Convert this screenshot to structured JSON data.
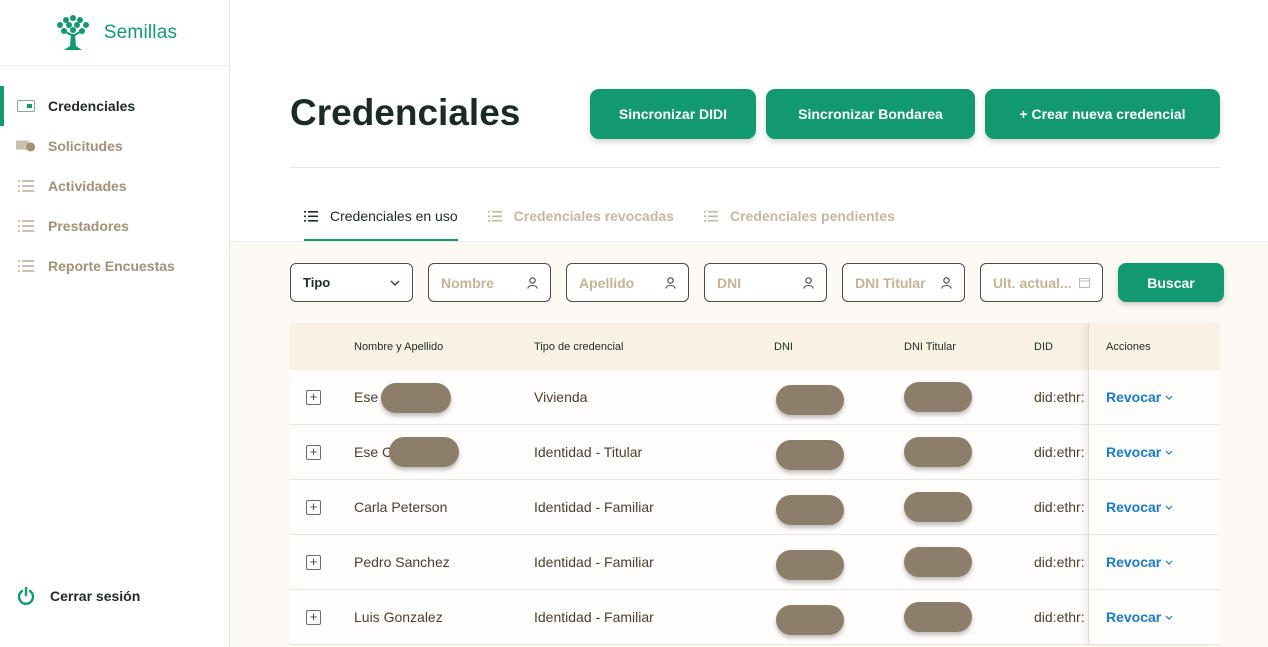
{
  "brand": {
    "name": "Semillas",
    "logo_icon": "tree-seeds-icon",
    "accent": "#13996f"
  },
  "sidebar": {
    "items": [
      {
        "label": "Credenciales",
        "icon": "credential-card-icon",
        "active": true
      },
      {
        "label": "Solicitudes",
        "icon": "requests-icon",
        "active": false
      },
      {
        "label": "Actividades",
        "icon": "list-icon",
        "active": false
      },
      {
        "label": "Prestadores",
        "icon": "list-icon",
        "active": false
      },
      {
        "label": "Reporte Encuestas",
        "icon": "list-icon",
        "active": false
      }
    ],
    "logout_label": "Cerrar sesión"
  },
  "header": {
    "title": "Credenciales",
    "buttons": [
      "Sincronizar DIDI",
      "Sincronizar Bondarea",
      "+ Crear nueva credencial"
    ]
  },
  "tabs": [
    {
      "label": "Credenciales en uso",
      "active": true
    },
    {
      "label": "Credenciales revocadas",
      "active": false
    },
    {
      "label": "Credenciales pendientes",
      "active": false
    }
  ],
  "filters": {
    "type_select": "Tipo",
    "nombre": "Nombre",
    "apellido": "Apellido",
    "dni": "DNI",
    "dni_titular": "DNI Titular",
    "ult_actual": "Ult. actual...",
    "search_label": "Buscar"
  },
  "table": {
    "columns": [
      "Nombre y Apellido",
      "Tipo de credencial",
      "DNI",
      "DNI Titular",
      "DID",
      "Acciones"
    ],
    "rows": [
      {
        "name": "Ese",
        "type": "Vivienda",
        "did": "did:ethr:",
        "action": "Revocar"
      },
      {
        "name": "Ese C",
        "type": "Identidad - Titular",
        "did": "did:ethr:",
        "action": "Revocar"
      },
      {
        "name": "Carla Peterson",
        "type": "Identidad - Familiar",
        "did": "did:ethr:",
        "action": "Revocar"
      },
      {
        "name": "Pedro Sanchez",
        "type": "Identidad - Familiar",
        "did": "did:ethr:",
        "action": "Revocar"
      },
      {
        "name": "Luis Gonzalez",
        "type": "Identidad - Familiar",
        "did": "did:ethr:",
        "action": "Revocar"
      }
    ]
  }
}
